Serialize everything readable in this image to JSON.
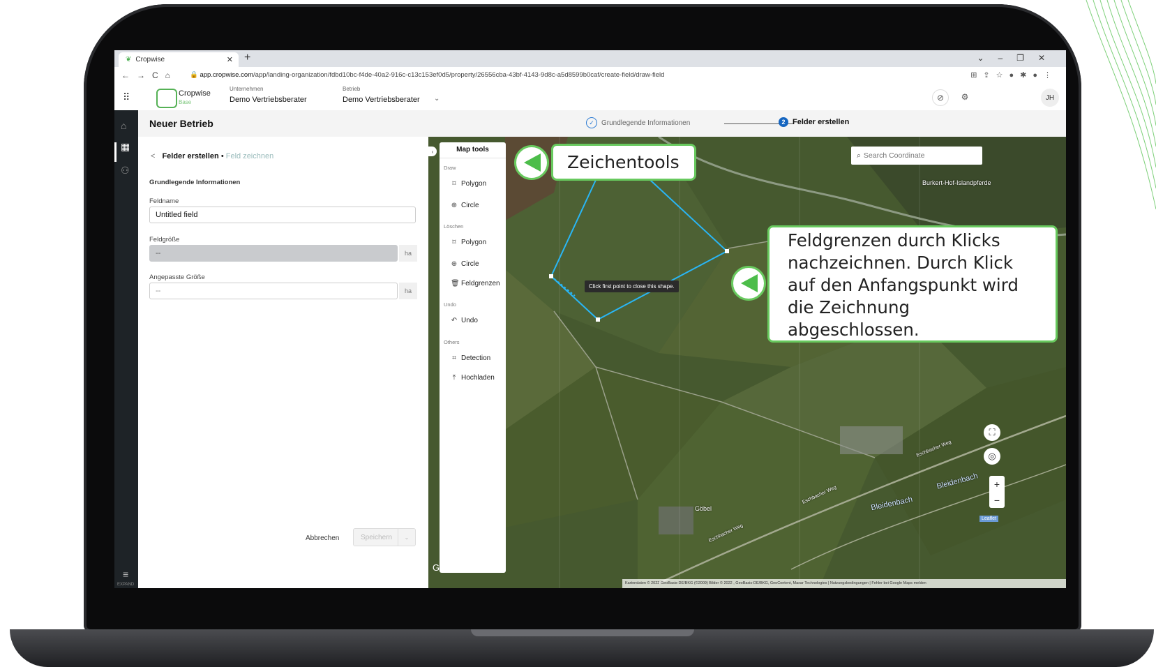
{
  "browser": {
    "tab_title": "Cropwise",
    "url_host": "app.cropwise.com",
    "url_path": "/app/landing-organization/fdbd10bc-f4de-40a2-916c-c13c153ef0d5/property/26556cba-43bf-4143-9d8c-a5d8599b0caf/create-field/draw-field"
  },
  "header": {
    "brand": "Cropwise",
    "brand_sub": "Base",
    "company_label": "Unternehmen",
    "company_value": "Demo Vertriebsberater",
    "farm_label": "Betrieb",
    "farm_value": "Demo Vertriebsberater",
    "avatar_initials": "JH"
  },
  "sidebar": {
    "expand_label": "EXPAND"
  },
  "page": {
    "title": "Neuer Betrieb",
    "steps": [
      {
        "label": "Grundlegende Informationen",
        "state": "done"
      },
      {
        "label": "Felder erstellen",
        "number": "2",
        "state": "current"
      }
    ]
  },
  "form": {
    "breadcrumb_main": "Felder erstellen",
    "breadcrumb_sep": " • ",
    "breadcrumb_sub": "Feld zeichnen",
    "section_title": "Grundlegende Informationen",
    "field_name_label": "Feldname",
    "field_name_value": "Untitled field",
    "field_size_label": "Feldgröße",
    "field_size_value": "--",
    "field_size_unit": "ha",
    "adjusted_size_label": "Angepasste Größe",
    "adjusted_size_value": "--",
    "adjusted_size_unit": "ha",
    "cancel_label": "Abbrechen",
    "save_label": "Speichern"
  },
  "map_tools": {
    "title": "Map tools",
    "groups": {
      "draw": "Draw",
      "delete": "Löschen",
      "undo": "Undo",
      "others": "Others"
    },
    "draw_polygon": "Polygon",
    "draw_circle": "Circle",
    "delete_polygon": "Polygon",
    "delete_circle": "Circle",
    "delete_boundaries": "Feldgrenzen",
    "undo": "Undo",
    "detection": "Detection",
    "upload": "Hochladen"
  },
  "map": {
    "search_placeholder": "Search Coordinate",
    "tooltip": "Click first point to close this shape.",
    "labels": {
      "place1": "Burkert-Hof-Islandpferde",
      "street1": "Eschbacher Weg",
      "street2": "Eschbacher Weg",
      "street3": "Eschbacher Weg",
      "place2": "Göbel",
      "river1": "Bleidenbach",
      "river2": "Bleidenbach"
    },
    "zoom_in": "+",
    "zoom_out": "−",
    "leaflet": "Leaflet",
    "google": "Google",
    "attribution": "Kartendaten © 2022 GeoBasis-DE/BKG (©2009) Bilder © 2022 , GeoBasis-DE/BKG, GeoContent, Maxar Technologies | Nutzungsbedingungen | Fehler bei Google Maps melden"
  },
  "callouts": {
    "tools": "Zeichentools",
    "drawing": "Feldgrenzen durch Klicks nachzeichnen. Durch Klick auf den Anfangspunkt wird die Zeichnung abgeschlossen."
  },
  "colors": {
    "accent_green": "#68c95e",
    "polygon_line": "#29b6f6",
    "step_blue": "#1565c0"
  }
}
